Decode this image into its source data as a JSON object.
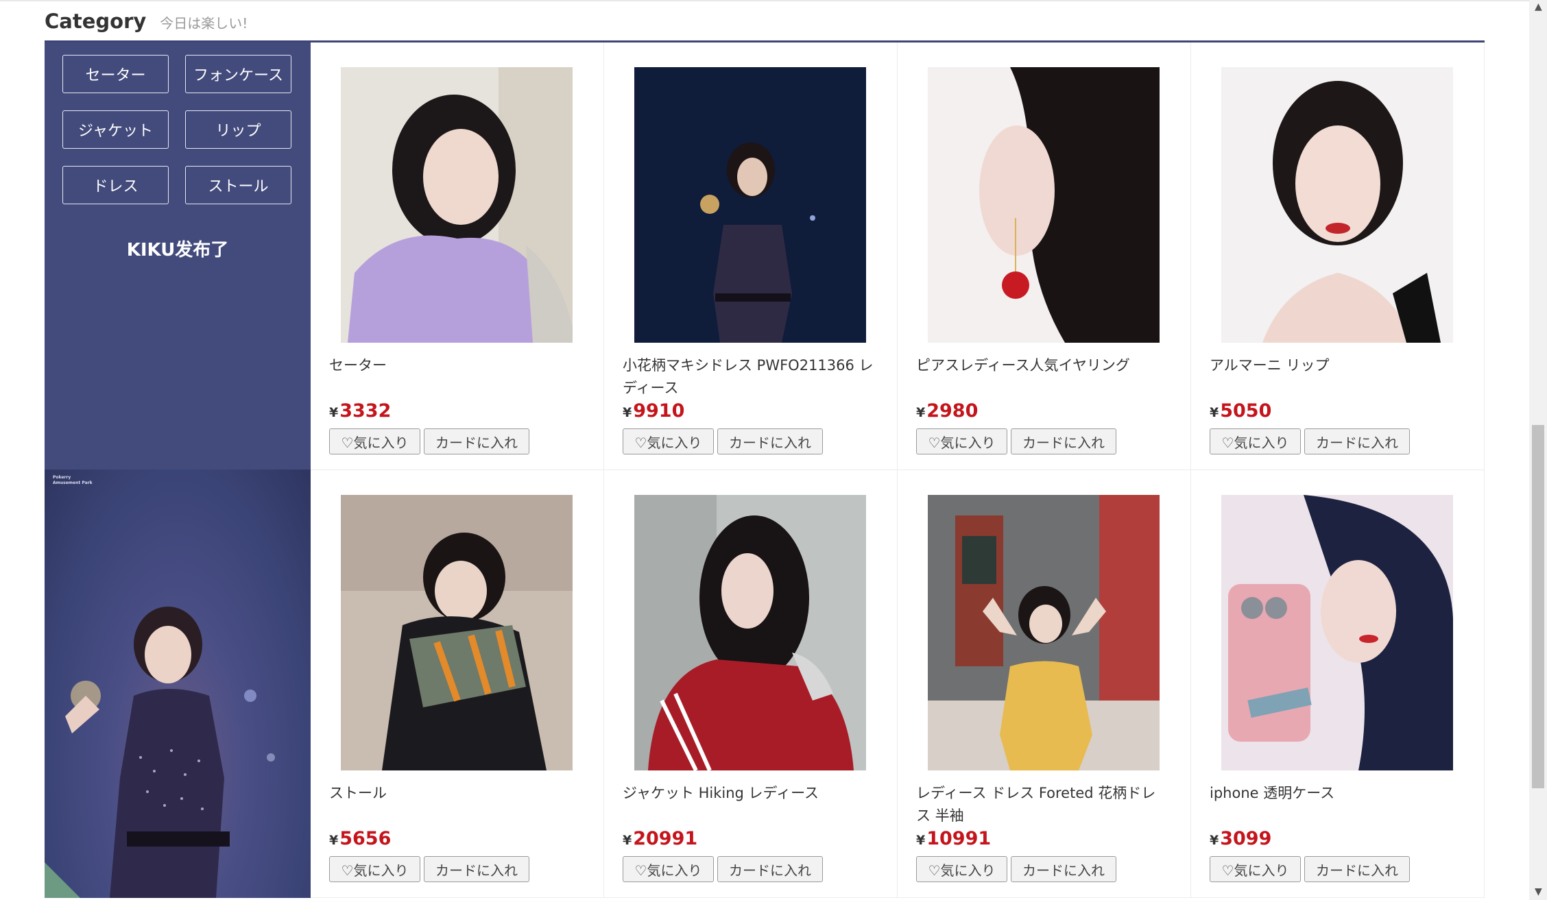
{
  "header": {
    "title": "Category",
    "subtitle": "今日は楽しい!"
  },
  "sidebar": {
    "categories": [
      "セーター",
      "フォンケース",
      "ジャケット",
      "リップ",
      "ドレス",
      "ストール"
    ],
    "caption": "KIKU发布了"
  },
  "promo": {
    "tag_line1": "Pokerry",
    "tag_line2": "Amusement Park"
  },
  "products": [
    {
      "name": "セーター",
      "currency": "¥",
      "price": "3332",
      "fav_label": "♡気に入り",
      "cart_label": "カードに入れ"
    },
    {
      "name": "小花柄マキシドレス PWFO211366 レディース",
      "currency": "¥",
      "price": "9910",
      "fav_label": "♡気に入り",
      "cart_label": "カードに入れ"
    },
    {
      "name": "ピアスレディース人気イヤリング",
      "currency": "¥",
      "price": "2980",
      "fav_label": "♡気に入り",
      "cart_label": "カードに入れ"
    },
    {
      "name": "アルマーニ リップ",
      "currency": "¥",
      "price": "5050",
      "fav_label": "♡気に入り",
      "cart_label": "カードに入れ"
    },
    {
      "name": "ストール",
      "currency": "¥",
      "price": "5656",
      "fav_label": "♡気に入り",
      "cart_label": "カードに入れ"
    },
    {
      "name": "ジャケット Hiking レディース",
      "currency": "¥",
      "price": "20991",
      "fav_label": "♡気に入り",
      "cart_label": "カードに入れ"
    },
    {
      "name": "レディース ドレス Foreted 花柄ドレス 半袖",
      "currency": "¥",
      "price": "10991",
      "fav_label": "♡気に入り",
      "cart_label": "カードに入れ"
    },
    {
      "name": "iphone 透明ケース",
      "currency": "¥",
      "price": "3099",
      "fav_label": "♡気に入り",
      "cart_label": "カードに入れ"
    }
  ]
}
